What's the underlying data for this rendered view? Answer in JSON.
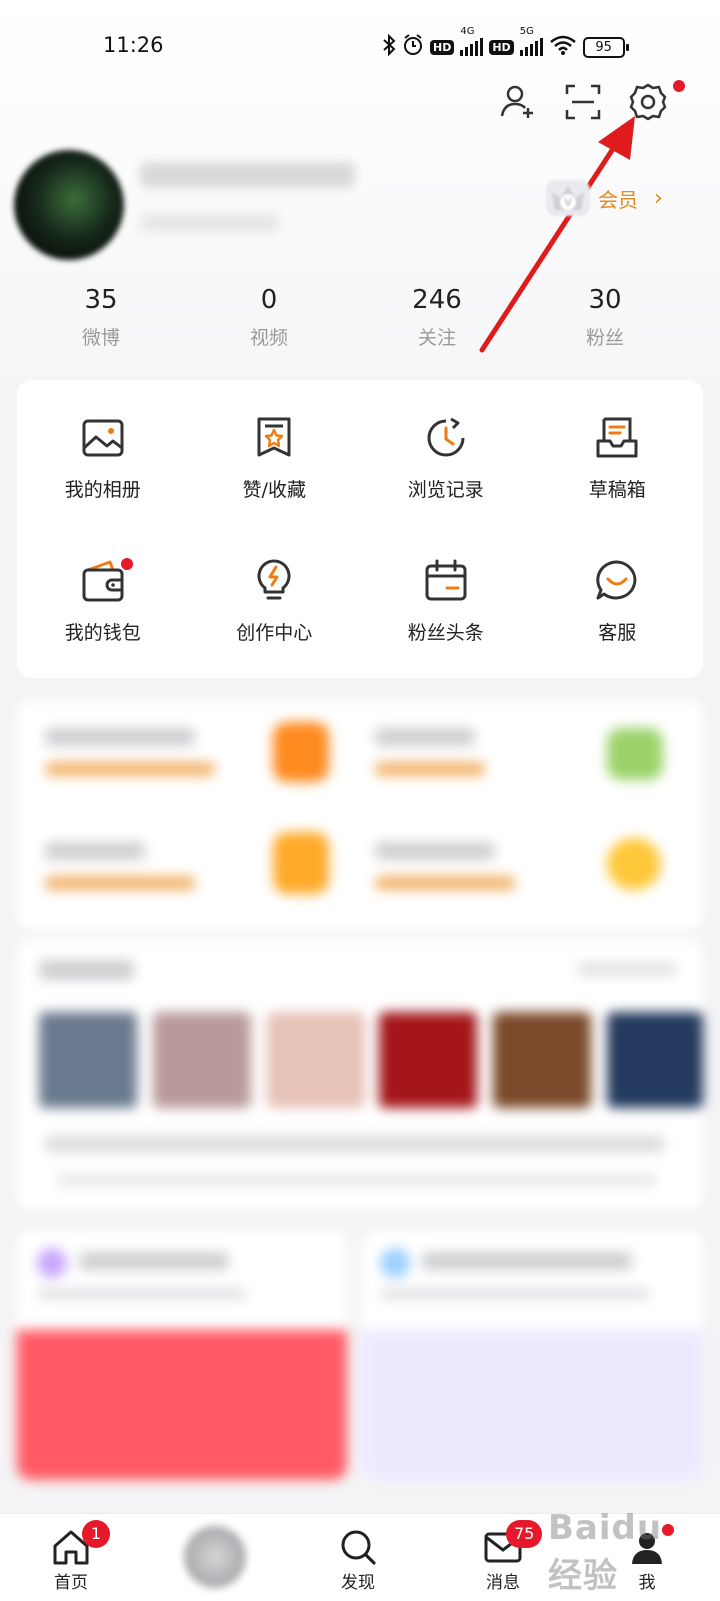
{
  "status_bar": {
    "time": "11:26",
    "hd1": "HD",
    "net1": "4G",
    "hd2": "HD",
    "net2": "5G",
    "battery": "95"
  },
  "header": {
    "vip_label": "会员",
    "vip_chevron": "›"
  },
  "stats": [
    {
      "value": "35",
      "label": "微博"
    },
    {
      "value": "0",
      "label": "视频"
    },
    {
      "value": "246",
      "label": "关注"
    },
    {
      "value": "30",
      "label": "粉丝"
    }
  ],
  "grid": {
    "items": [
      {
        "label": "我的相册",
        "icon": "photo-album-icon"
      },
      {
        "label": "赞/收藏",
        "icon": "bookmark-star-icon"
      },
      {
        "label": "浏览记录",
        "icon": "history-clock-icon"
      },
      {
        "label": "草稿箱",
        "icon": "drafts-tray-icon"
      },
      {
        "label": "我的钱包",
        "icon": "wallet-icon"
      },
      {
        "label": "创作中心",
        "icon": "lightbulb-icon"
      },
      {
        "label": "粉丝头条",
        "icon": "calendar-icon"
      },
      {
        "label": "客服",
        "icon": "chat-bubble-icon"
      }
    ]
  },
  "bottom_nav": {
    "home_label": "首页",
    "home_badge": "1",
    "discover_label": "发现",
    "messages_label": "消息",
    "messages_badge": "75",
    "me_label": "我"
  },
  "watermark": "Baidu经验",
  "colors": {
    "accent_orange": "#e38a1b",
    "badge_red": "#e6192b",
    "arrow_red": "#e01b1b"
  }
}
